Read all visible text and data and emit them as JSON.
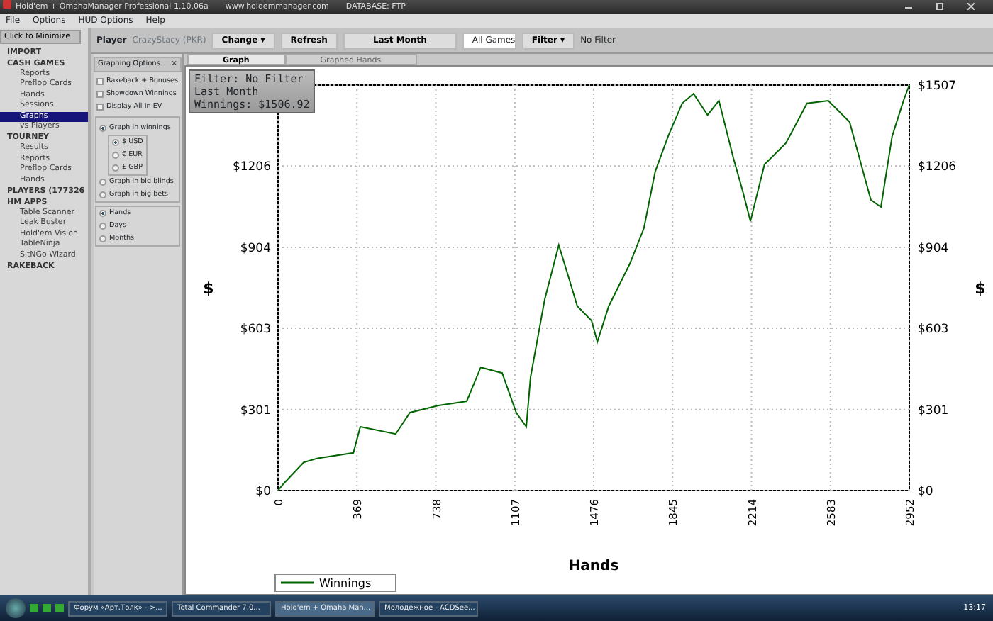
{
  "window": {
    "title": "Hold'em + OmahaManager Professional 1.10.06a",
    "url": "www.holdemmanager.com",
    "database": "DATABASE: FTP"
  },
  "menu": [
    "File",
    "Options",
    "HUD Options",
    "Help"
  ],
  "sidebar": {
    "minimize_button": "Click to Minimize",
    "items": [
      {
        "label": "IMPORT",
        "selected": false
      },
      {
        "label": "CASH GAMES",
        "selected": false,
        "children": [
          {
            "label": "Reports",
            "selected": false
          },
          {
            "label": "Preflop Cards",
            "selected": false
          },
          {
            "label": "Hands",
            "selected": false
          },
          {
            "label": "Sessions",
            "selected": false
          },
          {
            "label": "Graphs",
            "selected": true
          },
          {
            "label": "vs Players",
            "selected": false
          }
        ]
      },
      {
        "label": "TOURNEY",
        "selected": false,
        "children": [
          {
            "label": "Results",
            "selected": false
          },
          {
            "label": "Reports",
            "selected": false
          },
          {
            "label": "Preflop Cards",
            "selected": false
          },
          {
            "label": "Hands",
            "selected": false
          }
        ]
      },
      {
        "label": "PLAYERS (177326",
        "selected": false
      },
      {
        "label": "HM APPS",
        "selected": false,
        "children": [
          {
            "label": "Table Scanner",
            "selected": false
          },
          {
            "label": "Leak Buster",
            "selected": false
          },
          {
            "label": "Hold'em Vision",
            "selected": false
          },
          {
            "label": "TableNinja",
            "selected": false
          },
          {
            "label": "SitNGo Wizard",
            "selected": false
          }
        ]
      },
      {
        "label": "RAKEBACK",
        "selected": false
      }
    ]
  },
  "toolbar": {
    "player_label": "Player",
    "player": "CrazyStacy (PKR)",
    "change": "Change",
    "change_caret": "▾",
    "refresh": "Refresh",
    "period": "Last Month",
    "games": "All Games",
    "filter": "Filter",
    "filter_caret": "▾",
    "filter_value": "No Filter"
  },
  "tabs": [
    {
      "label": "Graph",
      "selected": true
    },
    {
      "label": "Graphed Hands",
      "selected": false
    }
  ],
  "options_panel": {
    "title": "Graphing Options",
    "close": "×",
    "checkboxes": [
      {
        "label": "Rakeback + Bonuses",
        "checked": false
      },
      {
        "label": "Showdown Winnings",
        "checked": false
      },
      {
        "label": "Display All-In EV",
        "checked": false
      }
    ],
    "units": [
      {
        "label": "Graph in winnings",
        "selected": true,
        "currencies": [
          {
            "label": "$ USD",
            "selected": true
          },
          {
            "label": "€ EUR",
            "selected": false
          },
          {
            "label": "£ GBP",
            "selected": false
          }
        ]
      },
      {
        "label": "Graph in big blinds",
        "selected": false
      },
      {
        "label": "Graph in big bets",
        "selected": false
      }
    ],
    "axis": [
      {
        "label": "Hands",
        "selected": true
      },
      {
        "label": "Days",
        "selected": false
      },
      {
        "label": "Months",
        "selected": false
      }
    ]
  },
  "info_box": [
    "Filter: No Filter",
    "Last Month",
    "Winnings: $1506.92"
  ],
  "chart_data": {
    "type": "line",
    "xlabel": "Hands",
    "ylabel": "$",
    "x": [
      0,
      26,
      120,
      186,
      352,
      385,
      550,
      617,
      750,
      882,
      948,
      1048,
      1114,
      1161,
      1181,
      1247,
      1313,
      1360,
      1400,
      1466,
      1493,
      1546,
      1645,
      1711,
      1764,
      1824,
      1890,
      1943,
      2009,
      2062,
      2129,
      2175,
      2209,
      2275,
      2375,
      2474,
      2573,
      2673,
      2772,
      2819,
      2872,
      2925,
      2952
    ],
    "series": [
      {
        "name": "Winnings",
        "color": "#006400",
        "values": [
          0,
          26,
          105,
          120,
          140,
          237,
          210,
          290,
          316,
          332,
          458,
          437,
          290,
          237,
          421,
          711,
          912,
          790,
          685,
          632,
          553,
          685,
          843,
          975,
          1186,
          1317,
          1439,
          1475,
          1396,
          1449,
          1238,
          1106,
          1001,
          1212,
          1291,
          1439,
          1449,
          1370,
          1080,
          1054,
          1317,
          1449,
          1507
        ]
      }
    ],
    "grid": true,
    "xlim": [
      0,
      2952
    ],
    "ylim": [
      0,
      1507
    ],
    "xticks": [
      0,
      369,
      738,
      1107,
      1476,
      1845,
      2214,
      2583,
      2952
    ],
    "yticks": [
      {
        "value": 0,
        "label": "$0"
      },
      {
        "value": 301,
        "label": "$301"
      },
      {
        "value": 603,
        "label": "$603"
      },
      {
        "value": 904,
        "label": "$904"
      },
      {
        "value": 1206,
        "label": "$1206"
      },
      {
        "value": 1507,
        "label": "$1507"
      }
    ]
  },
  "taskbar": {
    "items": [
      {
        "label": "Форум «Арт.Толк» - >...",
        "selected": false
      },
      {
        "label": "Total Commander 7.0...",
        "selected": false
      },
      {
        "label": "Hold'em + Omaha Man...",
        "selected": true
      },
      {
        "label": "Молодежное - ACDSee...",
        "selected": false
      }
    ],
    "clock": "13:17"
  }
}
